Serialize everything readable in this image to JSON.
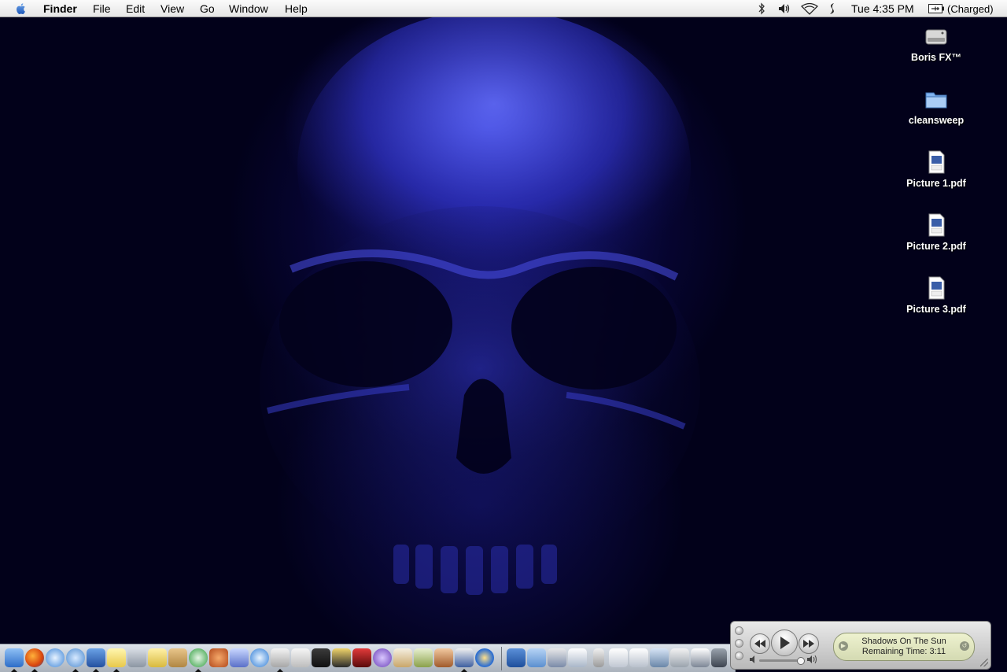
{
  "menubar": {
    "app_name": "Finder",
    "menus": [
      "File",
      "Edit",
      "View",
      "Go",
      "Window",
      "Help"
    ],
    "clock": "Tue 4:35 PM",
    "battery_status": "(Charged)",
    "status_icons": [
      "bluetooth-icon",
      "volume-icon",
      "wifi-icon",
      "script-icon",
      "battery-icon"
    ]
  },
  "desktop": {
    "icons": [
      {
        "label": "Boris  FX™",
        "icon": "hard-drive-icon"
      },
      {
        "label": "cleansweep",
        "icon": "folder-icon"
      },
      {
        "label": "Picture 1.pdf",
        "icon": "pdf-file-icon"
      },
      {
        "label": "Picture 2.pdf",
        "icon": "pdf-file-icon"
      },
      {
        "label": "Picture 3.pdf",
        "icon": "pdf-file-icon"
      }
    ]
  },
  "itunes": {
    "song": "Shadows On The Sun",
    "remaining": "Remaining Time: 3:11"
  },
  "colors": {
    "wallpaper_dark": "#02011a",
    "skull_blue": "#3b3fe0",
    "menubar_bg": "#f2f2f2",
    "lcd_bg": "#e2e6c0"
  }
}
